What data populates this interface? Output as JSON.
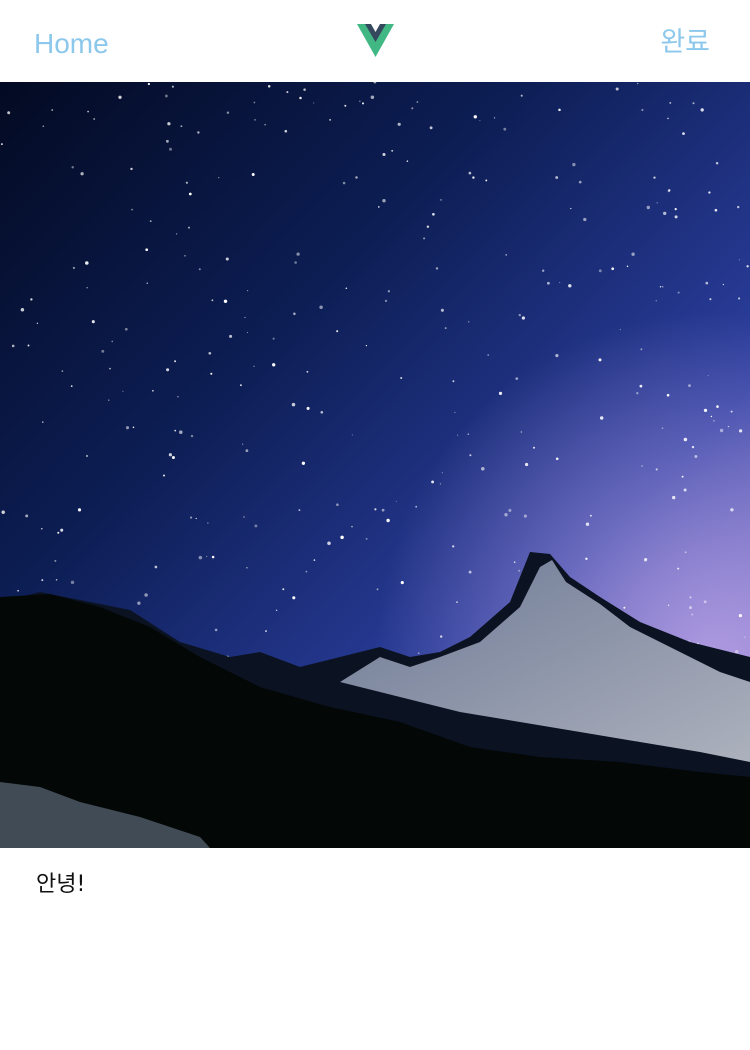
{
  "header": {
    "home_label": "Home",
    "done_label": "완료",
    "logo_icon": "vue-logo-icon",
    "link_color": "#8cc7ec"
  },
  "photo": {
    "subject": "starry-night-mountain-image"
  },
  "caption": {
    "text": "안녕!"
  }
}
